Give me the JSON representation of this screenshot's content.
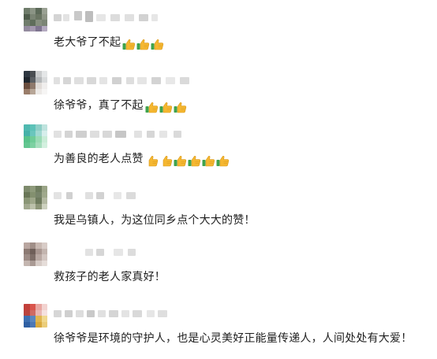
{
  "comments": [
    {
      "text": "老大爷了不起",
      "emojis": [
        "thumbs-up-green-cuff",
        "thumbs-up-green-cuff",
        "thumbs-up-green-cuff"
      ],
      "avatar_colors": [
        "#6e7b6a",
        "#8b9485",
        "#5c6a59",
        "#9aa193",
        "#4e5b4b",
        "#7a8474",
        "#6a7563",
        "#8e9586",
        "#707d6c",
        "#5f6d5b",
        "#868f7f",
        "#7b8575",
        "#938b9e",
        "#a398af",
        "#7f7590",
        "#b4aac0"
      ]
    },
    {
      "text": "徐爷爷，真了不起",
      "emojis": [
        "thumbs-up-green-cuff",
        "thumbs-up-green-cuff",
        "thumbs-up-green-cuff"
      ],
      "avatar_colors": [
        "#2d3640",
        "#4a4e52",
        "#c9cbcc",
        "#e4e6e7",
        "#1f262d",
        "#5b5f63",
        "#b4b7b9",
        "#d8dadb",
        "#6a4d3e",
        "#8f7a6c",
        "#e1dcd8",
        "#f0eeed",
        "#9a7d6a",
        "#b7a697",
        "#ece9e6",
        "#f6f5f4"
      ]
    },
    {
      "text": "为善良的老人点赞",
      "emojis": [
        "thumbs-up-plain",
        "thumbs-up-plain",
        "thumbs-up-green-cuff",
        "thumbs-up-green-cuff",
        "thumbs-up-green-cuff",
        "thumbs-up-green-cuff"
      ],
      "avatar_colors": [
        "#4fb9b0",
        "#5cc2b8",
        "#8ecfc7",
        "#bfe3de",
        "#45b1a8",
        "#6ac6bd",
        "#a1d9d2",
        "#d6eeeb",
        "#58c28a",
        "#6fcc98",
        "#9adbb5",
        "#c9ecd7",
        "#62c690",
        "#7dd1a2",
        "#a8dfbf",
        "#d3f0df"
      ]
    },
    {
      "text": "我是乌镇人，为这位同乡点个大大的赞！",
      "emojis": [],
      "avatar_colors": [
        "#7d8a6c",
        "#8e9a7b",
        "#6f7d5f",
        "#9aa486",
        "#697657",
        "#83906f",
        "#77846a",
        "#a0a98c",
        "#8a9676",
        "#9ea78a",
        "#6d7a5d",
        "#b3b9a2",
        "#a2a98f",
        "#bcc1ab",
        "#8d9679",
        "#cdd1bf"
      ]
    },
    {
      "text": "救孩子的老人家真好！",
      "emojis": [],
      "avatar_colors": [
        "#b9a6a0",
        "#a08e87",
        "#c8b8b1",
        "#d8ccc7",
        "#8c7a73",
        "#6f5f59",
        "#a89690",
        "#c3b5af",
        "#9d8c86",
        "#7e6e68",
        "#b8a8a2",
        "#d2c6c1",
        "#c4b6b0",
        "#a99a94",
        "#d6cbc6",
        "#e5ddd9"
      ]
    },
    {
      "text": "徐爷爷是环境的守护人，也是心灵美好正能量传递人，人间处处有大爱！",
      "emojis": [],
      "avatar_colors": [
        "#c2403a",
        "#d9544c",
        "#e8a6a1",
        "#f2d3d0",
        "#b9443e",
        "#cf6a63",
        "#e9b7b3",
        "#f5e1df",
        "#3d6fb0",
        "#5a86bf",
        "#e0b650",
        "#f0d88e",
        "#2f5fa3",
        "#4d78b5",
        "#d9a93c",
        "#ebcd7a"
      ]
    }
  ],
  "colors": {
    "text": "#1f1f1f",
    "name_blur": "#d9d9d9",
    "thumb_yellow": "#f5b731",
    "thumb_cuff": "#3fa34d"
  }
}
